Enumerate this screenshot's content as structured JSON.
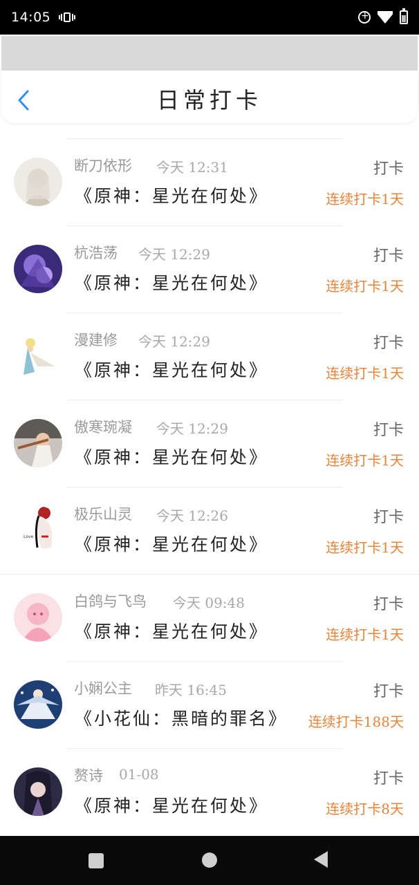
{
  "status_bar": {
    "time": "14:05"
  },
  "header": {
    "title": "日常打卡"
  },
  "colors": {
    "accent_blue": "#2f8ef0",
    "streak_orange": "#e8833a"
  },
  "checkins": [
    {
      "user": "断刀依形",
      "time": "今天 12:31",
      "book": "《原神：星光在何处》",
      "action": "打卡",
      "streak": "连续打卡1天"
    },
    {
      "user": "杭浩荡",
      "time": "今天 12:29",
      "book": "《原神：星光在何处》",
      "action": "打卡",
      "streak": "连续打卡1天"
    },
    {
      "user": "漫建修",
      "time": "今天 12:29",
      "book": "《原神：星光在何处》",
      "action": "打卡",
      "streak": "连续打卡1天"
    },
    {
      "user": "傲寒琬凝",
      "time": "今天 12:29",
      "book": "《原神：星光在何处》",
      "action": "打卡",
      "streak": "连续打卡1天"
    },
    {
      "user": "极乐山灵",
      "time": "今天 12:26",
      "book": "《原神：星光在何处》",
      "action": "打卡",
      "streak": "连续打卡1天"
    },
    {
      "user": "白鸽与飞鸟",
      "time": "今天 09:48",
      "book": "《原神：星光在何处》",
      "action": "打卡",
      "streak": "连续打卡1天"
    },
    {
      "user": "小娴公主",
      "time": "昨天 16:45",
      "book": "《小花仙：黑暗的罪名》",
      "action": "打卡",
      "streak": "连续打卡188天"
    },
    {
      "user": "赘诗",
      "time": "01-08",
      "book": "《原神：星光在何处》",
      "action": "打卡",
      "streak": "连续打卡8天"
    }
  ]
}
